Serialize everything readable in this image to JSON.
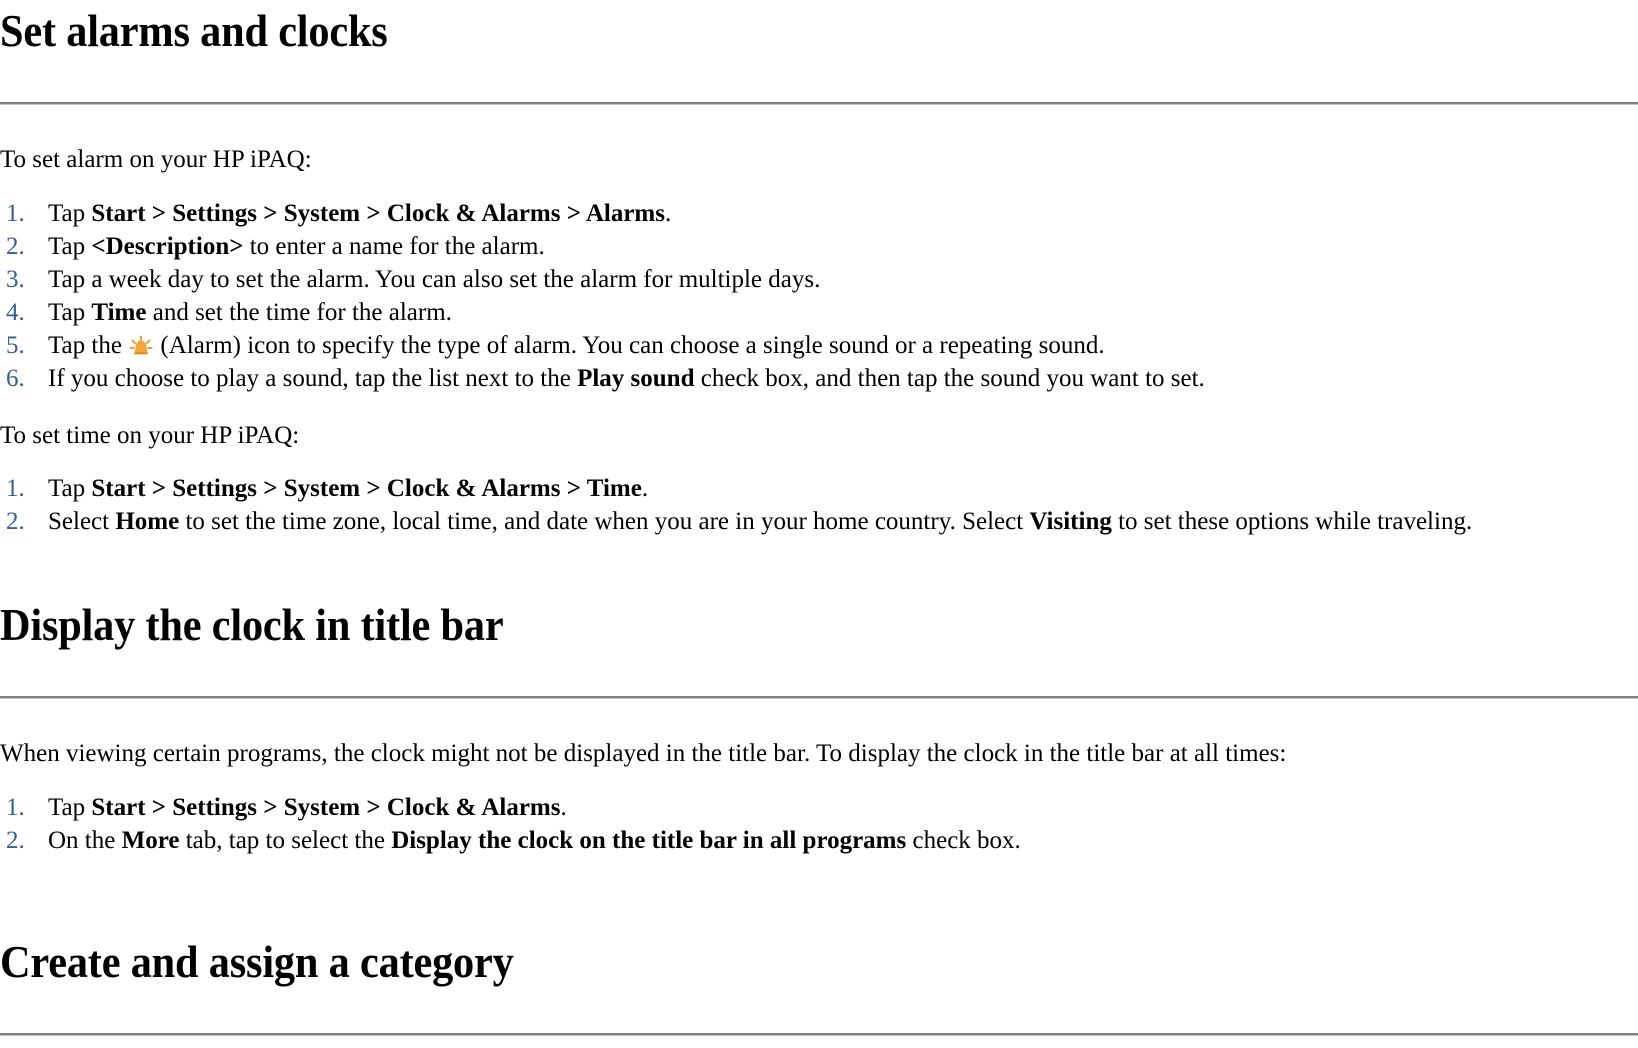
{
  "document": {
    "accent_number_color": "#365f91",
    "rule_color": "#808080",
    "text_color": "#000000",
    "background_color": "#ffffff"
  },
  "sections": [
    {
      "heading": "Set alarms and clocks",
      "intro_1": "To set alarm on your HP iPAQ:",
      "list_1": [
        {
          "num": "1.",
          "pre": "Tap ",
          "bold": "Start > Settings > System > Clock & Alarms > Alarms",
          "post": "."
        },
        {
          "num": "2.",
          "pre": "Tap ",
          "bold": "<Description>",
          "post": " to enter a name for the alarm."
        },
        {
          "num": "3.",
          "pre": "Tap a week day to set the alarm. You can also set the alarm for multiple days.",
          "bold": "",
          "post": ""
        },
        {
          "num": "4.",
          "pre": "Tap ",
          "bold": "Time",
          "post": " and set the time for the alarm."
        },
        {
          "num": "5.",
          "pre": "Tap the ",
          "icon": "alarm-icon",
          "post": " (Alarm) icon to specify the type of alarm. You can choose a single sound or a repeating sound."
        },
        {
          "num": "6.",
          "pre": "If you choose to play a sound, tap the list next to the ",
          "bold": "Play sound",
          "post": " check box, and then tap the sound you want to set."
        }
      ],
      "intro_2": "To set time on your HP iPAQ:",
      "list_2": [
        {
          "num": "1.",
          "pre": "Tap ",
          "bold": "Start > Settings > System > Clock & Alarms > Time",
          "post": "."
        },
        {
          "num": "2.",
          "pre": "Select ",
          "bold": "Home",
          "post": " to set the time zone, local time, and date when you are in your home country. Select ",
          "bold2": "Visiting",
          "post2": " to set these options while traveling."
        }
      ]
    },
    {
      "heading": "Display the clock in title bar",
      "intro_1": "When viewing certain programs, the clock might not be displayed in the title bar. To display the clock in the title bar at all times:",
      "list_1": [
        {
          "num": "1.",
          "pre": "Tap ",
          "bold": "Start > Settings > System > Clock & Alarms",
          "post": "."
        },
        {
          "num": "2.",
          "pre": "On the ",
          "bold": "More",
          "post": " tab, tap to select the ",
          "bold2": "Display the clock on the title bar in all programs",
          "post2": " check box."
        }
      ]
    },
    {
      "heading": "Create and assign a category"
    }
  ]
}
